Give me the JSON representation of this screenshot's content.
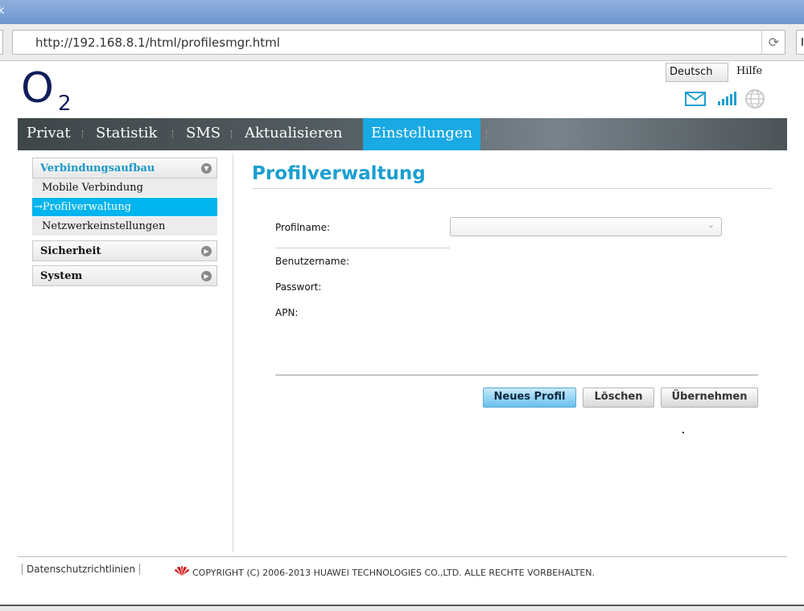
{
  "window": {
    "title_fragment": "k"
  },
  "browser": {
    "url": "http://192.168.8.1/html/profilesmgr.html",
    "right_stub": "I"
  },
  "header": {
    "logo_main": "O",
    "logo_sub": "2",
    "language": "Deutsch",
    "help": "Hilfe"
  },
  "nav": {
    "items": [
      "Privat",
      "Statistik",
      "SMS",
      "Aktualisieren",
      "Einstellungen"
    ],
    "active": "Einstellungen"
  },
  "sidebar": {
    "sections": [
      {
        "label": "Verbindungsaufbau",
        "expanded": true,
        "items": [
          "Mobile Verbindung",
          "→Profilverwaltung",
          "Netzwerkeinstellungen"
        ]
      },
      {
        "label": "Sicherheit",
        "expanded": false
      },
      {
        "label": "System",
        "expanded": false
      }
    ]
  },
  "main": {
    "title": "Profilverwaltung",
    "fields": {
      "profilname": "Profilname:",
      "benutzername": "Benutzername:",
      "passwort": "Passwort:",
      "apn": "APN:"
    },
    "profile_select_value": "",
    "buttons": {
      "new": "Neues Profil",
      "delete": "Löschen",
      "apply": "Übernehmen"
    }
  },
  "footer": {
    "privacy": "Datenschutzrichtlinien",
    "copyright": "COPYRIGHT (C) 2006-2013 HUAWEI TECHNOLOGIES CO.,LTD. ALLE RECHTE VORBEHALTEN."
  },
  "colors": {
    "accent": "#19a9e3",
    "title": "#1a9fd0",
    "logo": "#0f1e5a"
  }
}
